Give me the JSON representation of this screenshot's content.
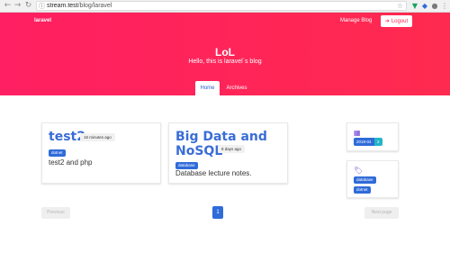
{
  "browser": {
    "url_host": "stream.test",
    "url_path": "/blog/laravel",
    "icons": {
      "back": "arrow-left-icon",
      "forward": "arrow-right-icon",
      "reload": "reload-icon",
      "secure": "info-icon",
      "bookmark": "star-icon"
    }
  },
  "header": {
    "brand": "laravel",
    "manage_link": "Manage Blog",
    "logout_label": "Logout",
    "title": "LoL",
    "subtitle": "Hello, this is laravel`s blog",
    "tabs": [
      {
        "label": "Home",
        "active": true
      },
      {
        "label": "Archives",
        "active": false
      }
    ],
    "colors": {
      "hero": "#ff2357",
      "accent": "#2f6bd9"
    }
  },
  "posts": [
    {
      "title": "test2",
      "time": "16 minutes ago",
      "tag": "dotnet",
      "body": "test2 and php"
    },
    {
      "title_line1": "Big Data and",
      "title_line2": "NoSQL",
      "time": "8 days ago",
      "tag": "database",
      "body": "Database lecture notes."
    }
  ],
  "sidebar": {
    "archives": {
      "icon": "calendar-icon",
      "date": "2018-04",
      "count": "2"
    },
    "tags": {
      "icon": "tags-icon",
      "items": [
        "database",
        "dotnet"
      ]
    }
  },
  "pagination": {
    "previous": "Previous",
    "current": "1",
    "next": "Next page"
  }
}
